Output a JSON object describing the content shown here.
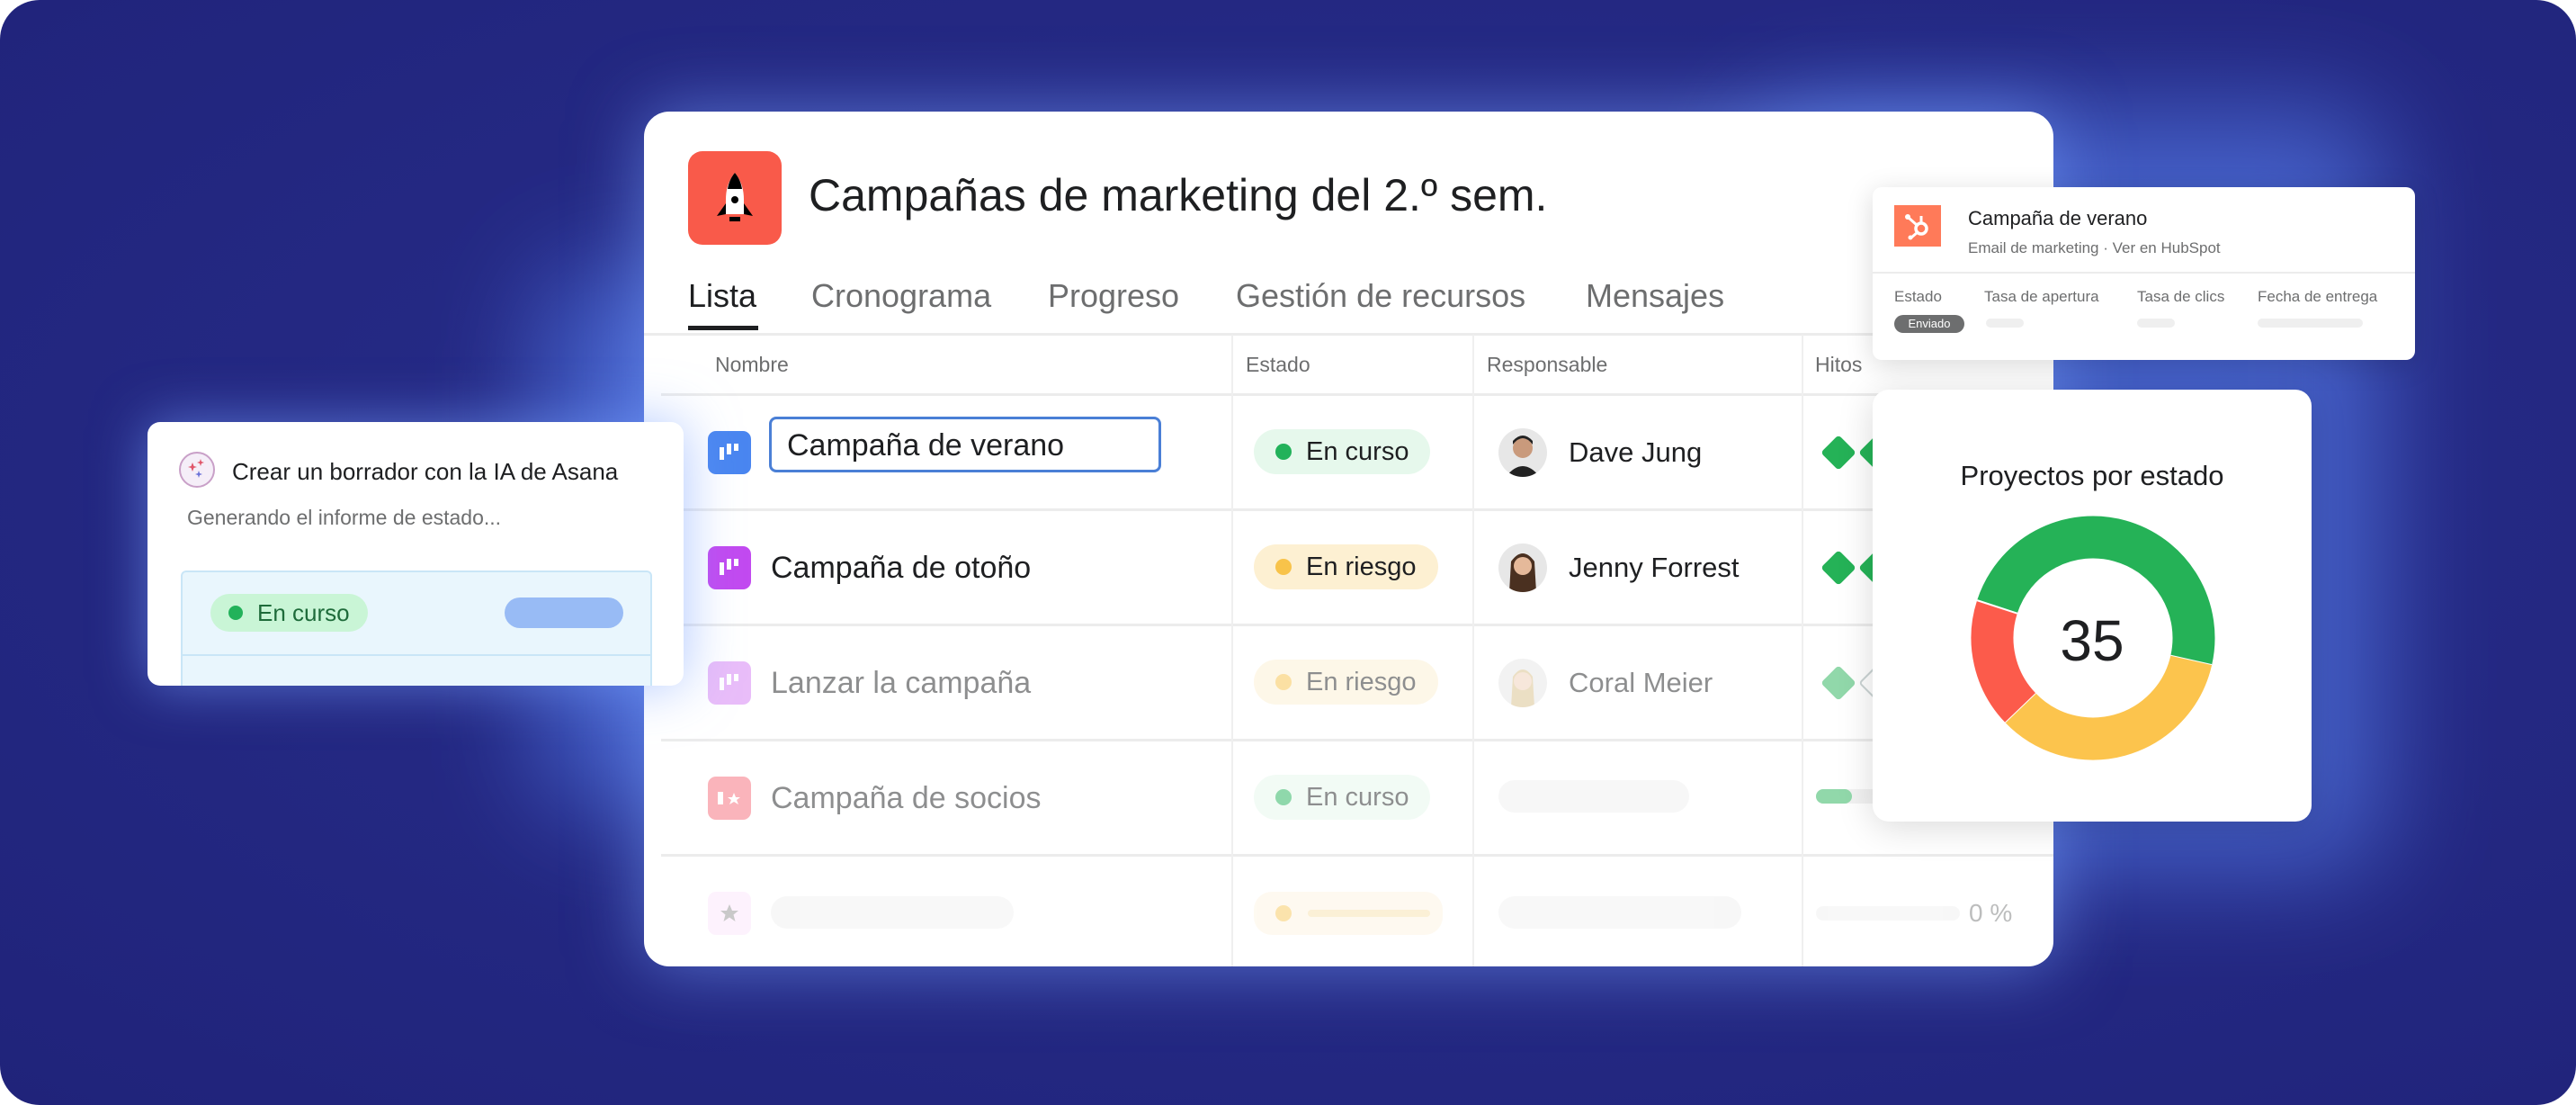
{
  "project": {
    "title": "Campañas de marketing del 2.º sem.",
    "icon": "rocket-icon",
    "icon_color": "#f95a4a"
  },
  "tabs": [
    {
      "label": "Lista",
      "active": true
    },
    {
      "label": "Cronograma"
    },
    {
      "label": "Progreso"
    },
    {
      "label": "Gestión de recursos"
    },
    {
      "label": "Mensajes"
    }
  ],
  "table": {
    "columns": [
      "Nombre",
      "Estado",
      "Responsable",
      "Hitos"
    ],
    "rows": [
      {
        "name": "Campaña de verano",
        "icon_color": "#4a86f0",
        "status": "En curso",
        "status_color": "#22b25a",
        "assignee": "Dave Jung",
        "editing": true
      },
      {
        "name": "Campaña de otoño",
        "icon_color": "#c24af0",
        "status": "En riesgo",
        "status_color": "#f8c34a",
        "assignee": "Jenny Forrest"
      },
      {
        "name": "Lanzar la campaña",
        "icon_color": "#d57ef5",
        "status": "En riesgo",
        "status_color": "#f8c34a",
        "assignee": "Coral Meier"
      },
      {
        "name": "Campaña de socios",
        "icon_color": "#f76c7a",
        "status": "En curso",
        "status_color": "#22b25a"
      },
      {
        "milestone_progress": "0 %"
      }
    ]
  },
  "hubspot": {
    "title": "Campaña de verano",
    "subtitle": "Email de marketing · Ver en HubSpot",
    "labels": [
      "Estado",
      "Tasa de apertura",
      "Tasa de clics",
      "Fecha de entrega"
    ],
    "status_badge": "Enviado",
    "brand_color": "#ff7a59"
  },
  "chart_data": {
    "type": "pie",
    "title": "Proyectos por estado",
    "total": "35",
    "values": [
      17,
      12,
      6
    ],
    "colors": [
      "#25b257",
      "#fcc44d",
      "#fc5b4b"
    ],
    "donut": true
  },
  "ai_card": {
    "title": "Crear un borrador con la IA de Asana",
    "subtitle": "Generando el informe de estado...",
    "status": "En curso"
  }
}
